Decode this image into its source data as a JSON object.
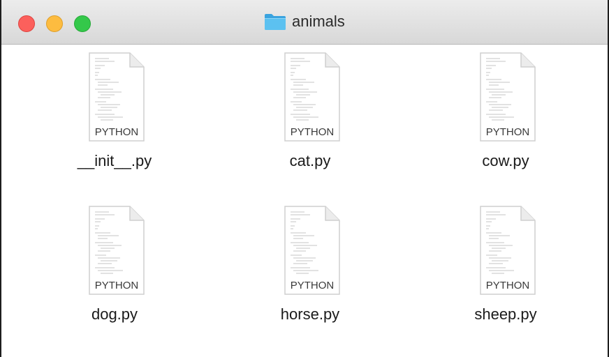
{
  "window": {
    "title": "animals",
    "folder_icon": "folder-icon",
    "controls": {
      "close_color": "#fc605c",
      "minimize_color": "#fdbc40",
      "zoom_color": "#34c84a"
    }
  },
  "files": [
    {
      "name": "__init__.py",
      "type_label": "PYTHON",
      "icon": "python-file-icon"
    },
    {
      "name": "cat.py",
      "type_label": "PYTHON",
      "icon": "python-file-icon"
    },
    {
      "name": "cow.py",
      "type_label": "PYTHON",
      "icon": "python-file-icon"
    },
    {
      "name": "dog.py",
      "type_label": "PYTHON",
      "icon": "python-file-icon"
    },
    {
      "name": "horse.py",
      "type_label": "PYTHON",
      "icon": "python-file-icon"
    },
    {
      "name": "sheep.py",
      "type_label": "PYTHON",
      "icon": "python-file-icon"
    }
  ]
}
